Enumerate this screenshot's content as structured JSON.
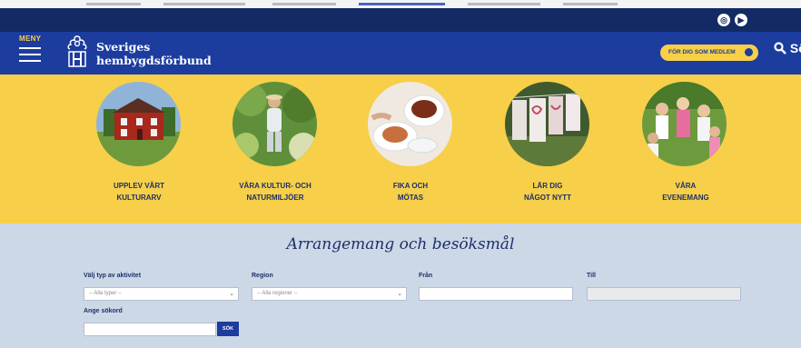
{
  "colors": {
    "topbar": "#132a64",
    "navbar": "#1c3c9e",
    "accent_yellow": "#f7cf48",
    "form_background": "#cdd8e6",
    "text_dark_blue": "#1c2f6b"
  },
  "social": {
    "instagram_icon": "instagram-icon",
    "youtube_icon": "youtube-icon"
  },
  "nav": {
    "menu_label": "MENY",
    "brand_line1": "Sveriges",
    "brand_line2": "hembygdsförbund",
    "member_button": "FÖR DIG SOM MEDLEM",
    "search_label": "Sö"
  },
  "categories": [
    {
      "line1": "UPPLEV VÅRT",
      "line2": "KULTURARV",
      "image": "red-house-photo"
    },
    {
      "line1": "VÅRA KULTUR- OCH",
      "line2": "NATURMILJÖER",
      "image": "nature-person-photo"
    },
    {
      "line1": "FIKA OCH",
      "line2": "MÖTAS",
      "image": "coffee-cup-photo"
    },
    {
      "line1": "LÄR DIG",
      "line2": "NÅGOT NYTT",
      "image": "textiles-photo"
    },
    {
      "line1": "VÅRA",
      "line2": "EVENEMANG",
      "image": "children-photo"
    }
  ],
  "events": {
    "title": "Arrangemang och besöksmål",
    "type_label": "Välj typ av aktivitet",
    "type_value": "-- Alla typer --",
    "region_label": "Region",
    "region_value": "-- Alla regioner --",
    "from_label": "Från",
    "from_value": "",
    "to_label": "Till",
    "to_value": "",
    "keyword_label": "Ange sökord",
    "keyword_value": "",
    "search_button": "SÖK"
  }
}
